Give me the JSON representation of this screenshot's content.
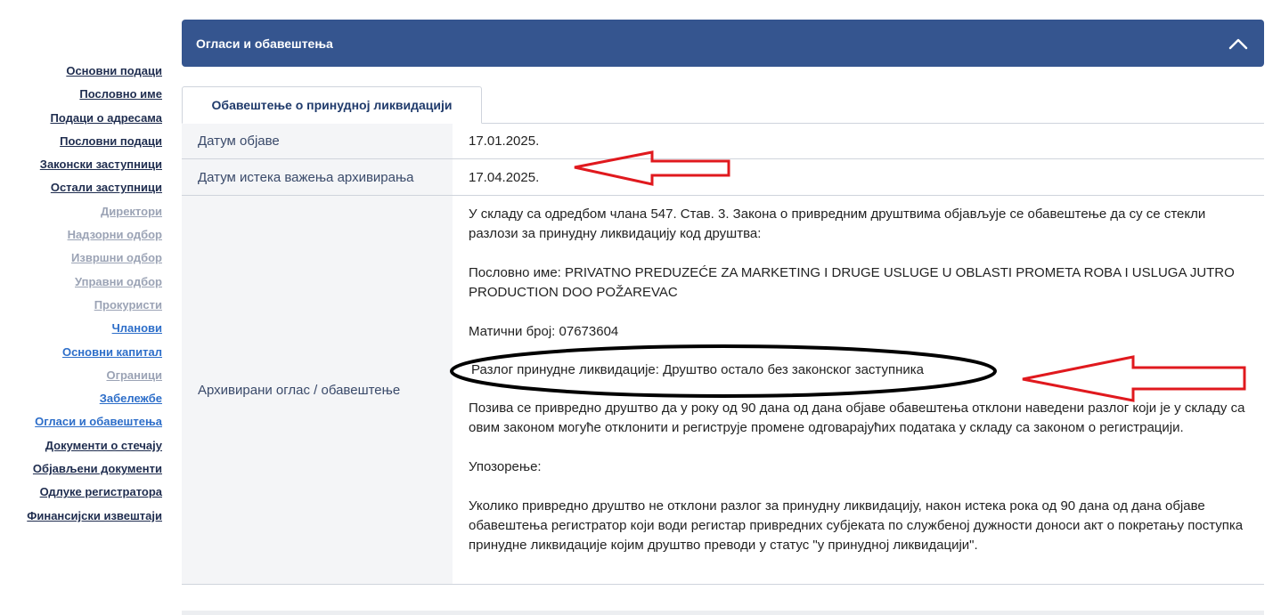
{
  "sidebar": {
    "items": [
      {
        "label": "Основни подаци",
        "style": "dark"
      },
      {
        "label": "Пословно име",
        "style": "dark"
      },
      {
        "label": "Подаци о адресама",
        "style": "dark"
      },
      {
        "label": "Пословни подаци",
        "style": "dark"
      },
      {
        "label": "Законски заступници",
        "style": "dark"
      },
      {
        "label": "Остали заступници",
        "style": "dark"
      },
      {
        "label": "Директори",
        "style": "muted"
      },
      {
        "label": "Надзорни одбор",
        "style": "muted"
      },
      {
        "label": "Извршни одбор",
        "style": "muted"
      },
      {
        "label": "Управни одбор",
        "style": "muted"
      },
      {
        "label": "Прокуристи",
        "style": "muted"
      },
      {
        "label": "Чланови",
        "style": "blue"
      },
      {
        "label": "Основни капитал",
        "style": "blue"
      },
      {
        "label": "Ограници",
        "style": "muted"
      },
      {
        "label": "Забележбе",
        "style": "blue"
      },
      {
        "label": "Огласи и обавештења",
        "style": "blue"
      },
      {
        "label": "Документи о стечају",
        "style": "dark"
      },
      {
        "label": "Објављени документи",
        "style": "dark"
      },
      {
        "label": "Одлуке регистратора",
        "style": "dark"
      },
      {
        "label": "Финансијски извештаји",
        "style": "dark"
      }
    ]
  },
  "panel": {
    "title": "Огласи и обавештења",
    "collapse_icon": "chevron-up-icon"
  },
  "tab": {
    "label": "Обавештење о принудној ликвидацији"
  },
  "details": {
    "publish_date_label": "Датум објаве",
    "publish_date": "17.01.2025.",
    "archive_expiry_label": "Датум истека важења архивирања",
    "archive_expiry": "17.04.2025.",
    "archived_notice_label": "Архивирани оглас / обавештење",
    "notice": {
      "p1": "У складу са одредбом члана 547. Став. 3. Закона о привредним друштвима објављује се обавештење да су се стекли разлози за принудну ликвидацију код друштва:",
      "p2": "Пословно име: PRIVATNO PREDUZEĆE ZA MARKETING I DRUGE USLUGE U OBLASTI PROMETA ROBA I USLUGA JUTRO PRODUCTION DOO POŽAREVAC",
      "p3": "Матични број: 07673604",
      "p4": "Разлог принудне ликвидације: Друштво остало без законског заступника",
      "p5": "Позива се привредно друштво да у року од 90 дана од дана објаве обавештења отклони наведени разлог који је у складу са овим законом могуће отклонити и региструје промене одговарајућих података у складу са законом о регистрацији.",
      "p6": "Упозорење:",
      "p7": "Уколико привредно друштво не отклони разлог за принудну ликвидацију, након истека рока од 90 дана од дана објаве обавештења регистратор који води регистар привредних субјеката по службеној дужности доноси акт о покретању поступка принудне ликвидације којим друштво преводи у статус \"у принудној ликвидацији\"."
    }
  },
  "annotations": {
    "arrow_color": "#e0191e",
    "ellipse_color": "#000000"
  }
}
